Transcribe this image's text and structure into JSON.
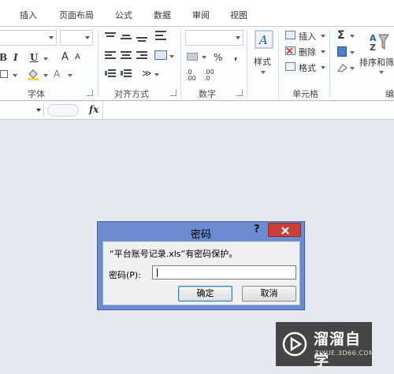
{
  "tabs": [
    "插入",
    "页面布局",
    "公式",
    "数据",
    "审阅",
    "视图"
  ],
  "ribbon": {
    "groups": {
      "font": "字体",
      "alignment": "对齐方式",
      "number": "数字",
      "cells": "单元格",
      "editing_partial": "编"
    },
    "font": {
      "bold": "B",
      "italic": "I",
      "underline": "U",
      "grow": "A",
      "shrink": "A",
      "font_color": "A"
    },
    "number": {
      "percent": "%",
      "comma": ",",
      "inc_decimal": ".0 .00",
      "dec_decimal": ".00 .0"
    },
    "styles_label": "样式",
    "cells": {
      "insert": "插入",
      "delete": "删除",
      "format": "格式"
    },
    "editing": {
      "sum": "Σ",
      "sort_filter": "排序和筛"
    }
  },
  "formula_bar": {
    "fx": "fx"
  },
  "dialog": {
    "title": "密码",
    "help": "?",
    "message": "“平台账号记录.xls”有密码保护。",
    "password_label": "密码(P):",
    "password_value": "",
    "ok": "确定",
    "cancel": "取消"
  },
  "watermark": {
    "title": "溜溜自学",
    "subtitle": "ZIXUE.3D66.COM"
  }
}
